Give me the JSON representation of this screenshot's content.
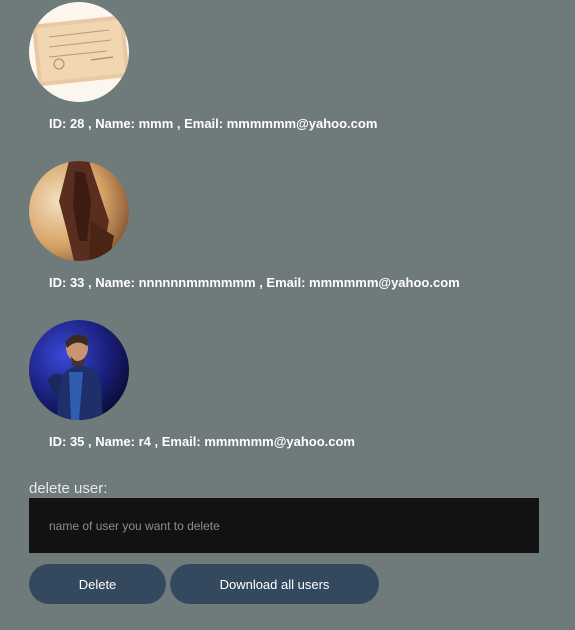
{
  "users": [
    {
      "id_text": "ID: 28 , Name: mmm , Email: mmmmmm@yahoo.com"
    },
    {
      "id_text": "ID: 33 , Name: nnnnnnmmmmmm , Email: mmmmmm@yahoo.com"
    },
    {
      "id_text": "ID: 35 , Name: r4 , Email: mmmmmm@yahoo.com"
    }
  ],
  "delete_section": {
    "label": "delete user:",
    "placeholder": "name of user you want to delete"
  },
  "buttons": {
    "delete": "Delete",
    "download": "Download all users"
  },
  "colors": {
    "page_background": "#6f7a7b",
    "input_background": "#121212",
    "button_background": "#34495e",
    "text": "#ffffff"
  }
}
